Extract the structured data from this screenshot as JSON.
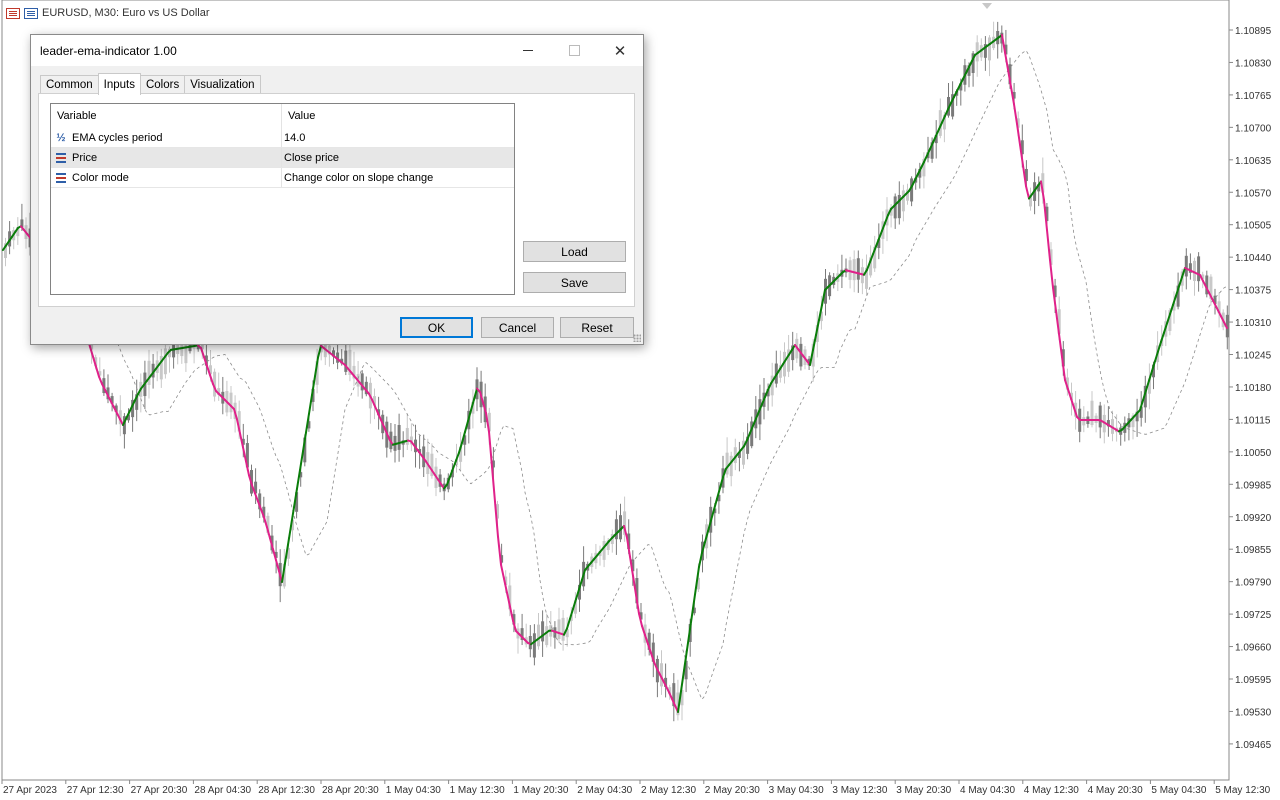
{
  "chart": {
    "header": "EURUSD, M30:  Euro vs US Dollar",
    "price_labels": [
      "1.10895",
      "1.10830",
      "1.10765",
      "1.10700",
      "1.10635",
      "1.10570",
      "1.10505",
      "1.10440",
      "1.10375",
      "1.10310",
      "1.10245",
      "1.10180",
      "1.10115",
      "1.10050",
      "1.09985",
      "1.09920",
      "1.09855",
      "1.09790",
      "1.09725",
      "1.09660",
      "1.09595",
      "1.09530",
      "1.09465"
    ],
    "time_labels": [
      "27 Apr 2023",
      "27 Apr 12:30",
      "27 Apr 20:30",
      "28 Apr 04:30",
      "28 Apr 12:30",
      "28 Apr 20:30",
      "1 May 04:30",
      "1 May 12:30",
      "1 May 20:30",
      "2 May 04:30",
      "2 May 12:30",
      "2 May 20:30",
      "3 May 04:30",
      "3 May 12:30",
      "3 May 20:30",
      "4 May 04:30",
      "4 May 12:30",
      "4 May 20:30",
      "5 May 04:30",
      "5 May 12:30"
    ],
    "colors": {
      "up_line": "#0a7d0a",
      "down_line": "#e0218a",
      "candle_bull": "#c8c8c8",
      "candle_bear": "#7a7a7a",
      "dotted_ema": "#8c8c8c"
    }
  },
  "dialog": {
    "title": "leader-ema-indicator 1.00",
    "tabs": [
      {
        "label": "Common"
      },
      {
        "label": "Inputs"
      },
      {
        "label": "Colors"
      },
      {
        "label": "Visualization"
      }
    ],
    "grid": {
      "headers": {
        "variable": "Variable",
        "value": "Value"
      },
      "rows": [
        {
          "variable": "EMA cycles period",
          "value": "14.0",
          "icon": "fraction-icon"
        },
        {
          "variable": "Price",
          "value": "Close price",
          "icon": "enum-list-icon"
        },
        {
          "variable": "Color mode",
          "value": "Change color on slope change",
          "icon": "enum-list-icon"
        }
      ]
    },
    "buttons": {
      "load": "Load",
      "save": "Save",
      "ok": "OK",
      "cancel": "Cancel",
      "reset": "Reset"
    }
  }
}
